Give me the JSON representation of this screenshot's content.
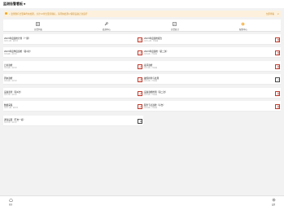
{
  "header": {
    "title": "监测告警看板"
  },
  "notice": {
    "text": "• 监测到有告警事件未处理，共计12条告警待确认，请尽快处理以保障设备正常运行",
    "link": "立即查看",
    "close": "×"
  },
  "tabs": [
    {
      "label": "告警列表",
      "icon": "list-icon"
    },
    {
      "label": "处理中心",
      "icon": "wrench-icon"
    },
    {
      "label": "告警统计",
      "icon": "chart-icon"
    },
    {
      "label": "配置中心",
      "icon": "gear-icon"
    }
  ],
  "cards": [
    {
      "title": "2023年度巡检计划（一期）",
      "sub": "共计12项 · 进行中",
      "btn": "edit"
    },
    {
      "title": "2023年度巡检报告",
      "sub": "共计10项 · 已完成",
      "btn": "delete"
    },
    {
      "title": "2023年度季度巡检（第2次）",
      "sub": "共计8项 · 进行中",
      "btn": "edit"
    },
    {
      "title": "2023年度巡检（第二次）",
      "sub": "共计6项 · 已完成",
      "btn": "delete"
    },
    {
      "title": "日常巡检",
      "sub": "共计4项 · 进行中",
      "btn": "edit"
    },
    {
      "title": "夜间巡检",
      "sub": "共计3项 · 已完成",
      "btn": "delete"
    },
    {
      "title": "周末巡检",
      "sub": "共计5项 · 进行中",
      "btn": "edit"
    },
    {
      "title": "故障排查与处理",
      "sub": "共计2项 · 已完成",
      "btn": "done"
    },
    {
      "title": "设备巡查（第2次）",
      "sub": "共计7项 · 进行中",
      "btn": "edit"
    },
    {
      "title": "设备巡检检测（第二次）",
      "sub": "共计9项 · 已完成",
      "btn": "delete"
    },
    {
      "title": "数据采集",
      "sub": "共计11项 · 进行中",
      "btn": "edit"
    },
    {
      "title": "服务节点巡检（平台）",
      "sub": "共计4项 · 已完成",
      "btn": "delete"
    },
    {
      "title": "通知设置（开启一项）",
      "sub": "共计1项 · 进行中",
      "btn": "edit"
    }
  ],
  "bottom_nav": [
    {
      "label": "首页",
      "icon": "home-icon"
    },
    {
      "label": "设置",
      "icon": "settings-icon"
    }
  ],
  "colors": {
    "accent": "#c0392b",
    "notice_bg": "#fdf1dd",
    "notice_text": "#c98b2a",
    "tab_icon": "#333333",
    "gear": "#f5a623"
  }
}
